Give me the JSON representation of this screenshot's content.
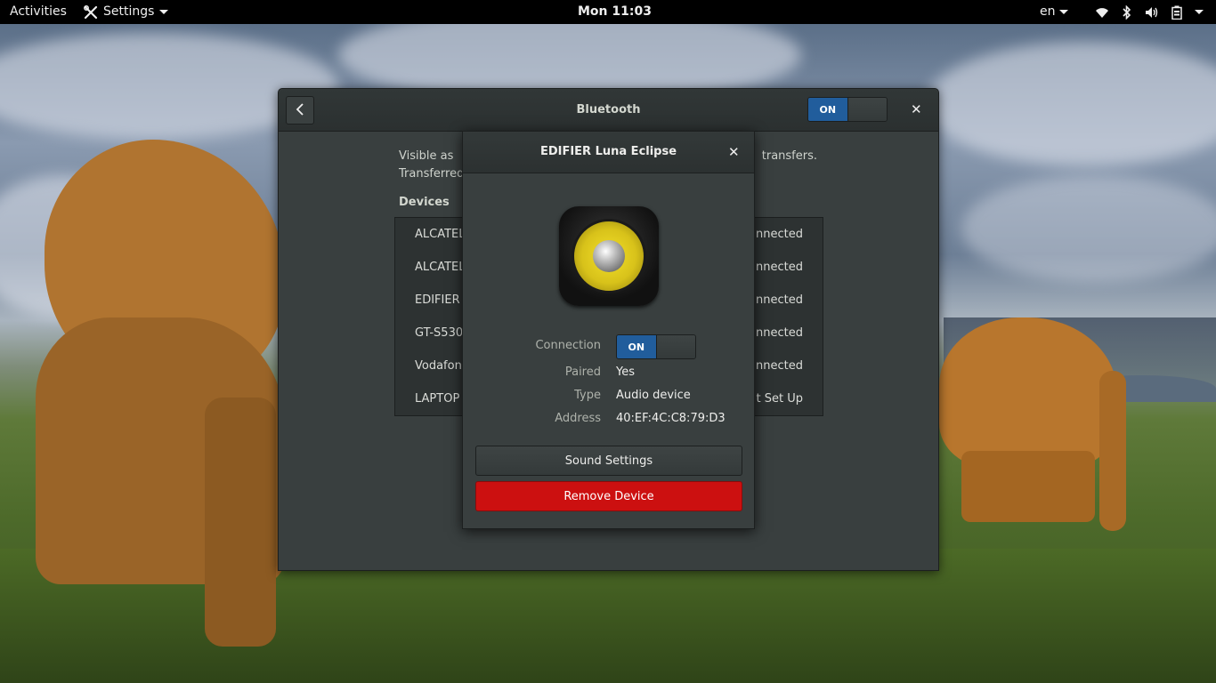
{
  "topbar": {
    "activities": "Activities",
    "app_menu": "Settings",
    "clock": "Mon 11:03",
    "language": "en",
    "icons": [
      "wifi-icon",
      "bluetooth-icon",
      "volume-icon",
      "battery-icon"
    ]
  },
  "window": {
    "title": "Bluetooth",
    "switch_label": "ON",
    "visible_text_left": "Visible as",
    "visible_text_right": "transfers.",
    "visible_text_line2": "Transferred",
    "devices_heading": "Devices",
    "devices": [
      {
        "name": "ALCATEL",
        "status": "nnected"
      },
      {
        "name": "ALCATEL",
        "status": "nnected"
      },
      {
        "name": "EDIFIER",
        "status": "nnected"
      },
      {
        "name": "GT-S530",
        "status": "nnected"
      },
      {
        "name": "Vodafon",
        "status": "nnected"
      },
      {
        "name": "LAPTOP",
        "status": "t Set Up"
      }
    ]
  },
  "dialog": {
    "title": "EDIFIER Luna Eclipse",
    "icon": "speaker-icon",
    "connection_label": "Connection",
    "connection_state": "ON",
    "paired_label": "Paired",
    "paired_value": "Yes",
    "type_label": "Type",
    "type_value": "Audio device",
    "address_label": "Address",
    "address_value": "40:EF:4C:C8:79:D3",
    "sound_settings": "Sound Settings",
    "remove_device": "Remove Device"
  },
  "colors": {
    "accent": "#215d9c",
    "destructive": "#cc1010",
    "window_bg": "#393f3f",
    "topbar_bg": "#000000"
  }
}
